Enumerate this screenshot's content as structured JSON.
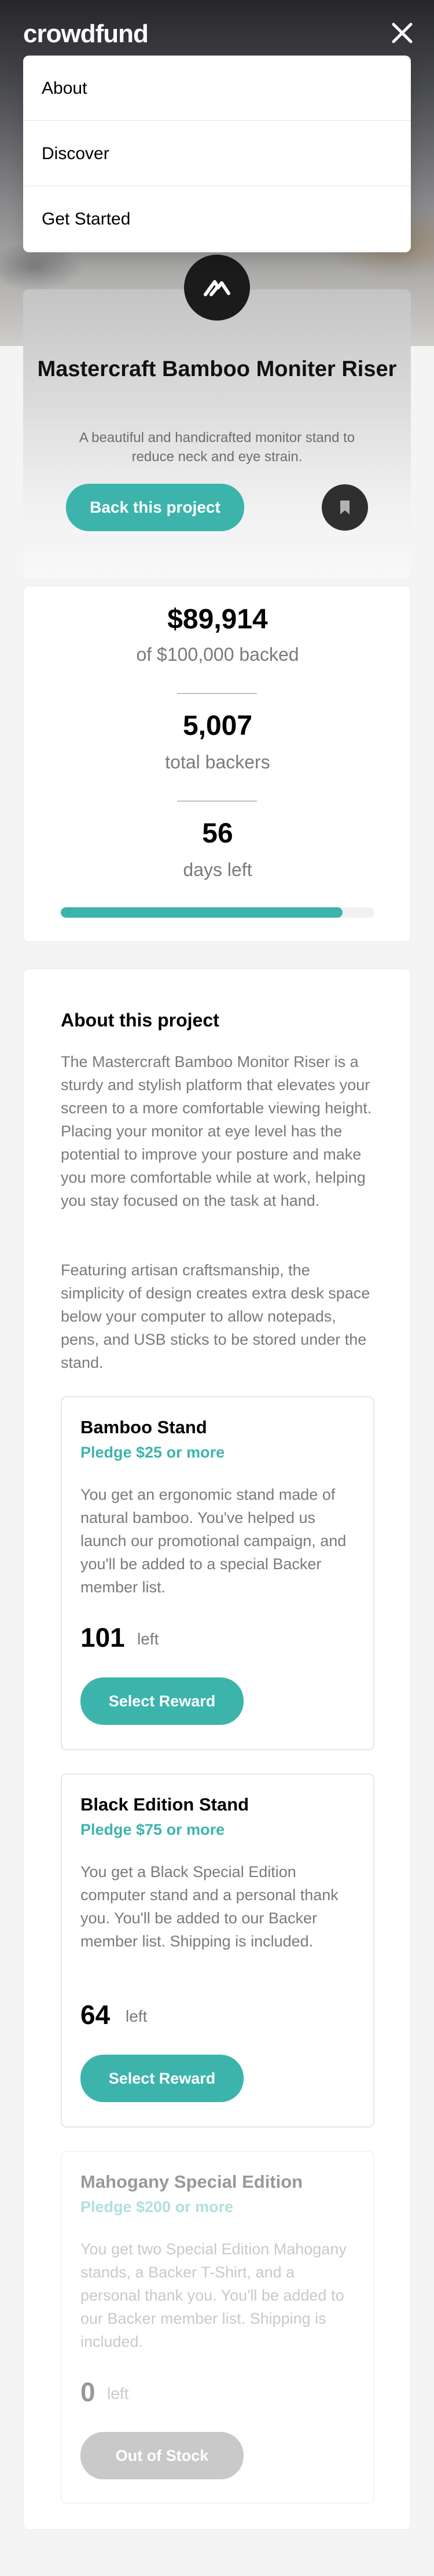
{
  "header": {
    "logo": "crowdfund",
    "menu": [
      {
        "label": "About"
      },
      {
        "label": "Discover"
      },
      {
        "label": "Get Started"
      }
    ]
  },
  "project": {
    "title": "Mastercraft Bamboo Moniter Riser",
    "description": "A beautiful and handicrafted monitor stand to reduce neck and eye strain.",
    "back_label": "Back this project"
  },
  "stats": {
    "backed_amount": "$89,914",
    "backed_label": "of $100,000 backed",
    "backers": "5,007",
    "backers_label": "total backers",
    "days": "56",
    "days_label": "days left",
    "progress_fraction": 0.899
  },
  "about": {
    "title": "About this project",
    "paragraphs": [
      "The Mastercraft Bamboo Monitor Riser is a sturdy and stylish platform that elevates your screen to a more comfortable viewing height. Placing your monitor at eye level has the potential to improve your posture and make you more comfortable while at work, helping you stay focused on the task at hand.",
      "Featuring artisan craftsmanship, the simplicity of design creates extra desk space below your computer to allow notepads, pens, and USB sticks to be stored under the stand."
    ]
  },
  "rewards": [
    {
      "name": "Bamboo Stand",
      "pledge": "Pledge $25 or more",
      "description": "You get an ergonomic stand made of natural bamboo. You've helped us launch our promotional campaign, and you'll be added to a special Backer member list.",
      "left": "101",
      "left_label": "left",
      "button": "Select Reward"
    },
    {
      "name": "Black Edition Stand",
      "pledge": "Pledge $75 or more",
      "description": "You get a Black Special Edition computer stand and a personal thank you. You'll be added to our Backer member list. Shipping is included.",
      "left": "64",
      "left_label": "left",
      "button": "Select Reward"
    },
    {
      "name": "Mahogany Special Edition",
      "pledge": "Pledge $200 or more",
      "description": "You get two Special Edition Mahogany stands, a Backer T-Shirt, and a personal thank you. You'll be added to our Backer member list. Shipping is included.",
      "left": "0",
      "left_label": "left",
      "button": "Out of Stock"
    }
  ],
  "colors": {
    "accent": "#3cb4ac",
    "dark": "#2f2f2f",
    "muted_text": "#7a7a7a"
  },
  "icons": {
    "close": "close-icon",
    "bookmark": "bookmark-icon",
    "project_logo": "mastercraft-logo-icon"
  }
}
